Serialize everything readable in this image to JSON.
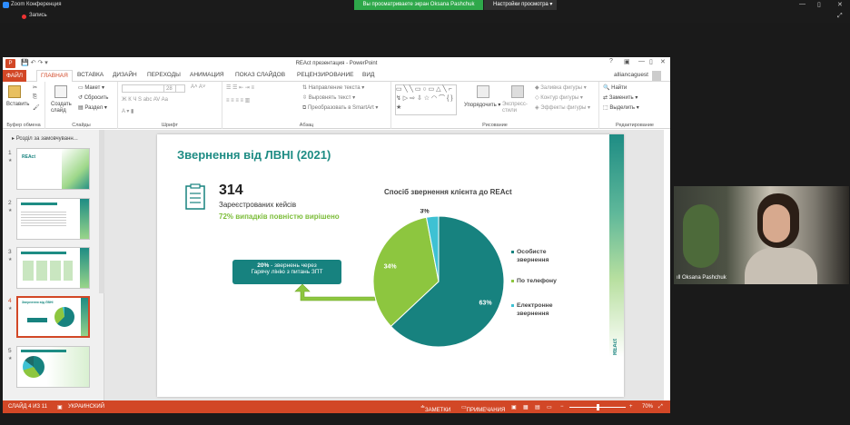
{
  "zoom": {
    "app_title": "Zoom Конференция",
    "share_banner": "Вы просматриваете экран Oksana Pashchuk",
    "share_settings": "Настройки просмотра",
    "record_label": "Запись"
  },
  "ppt": {
    "window_title": "REAct презентация - PowerPoint",
    "tabs": [
      "ФАЙЛ",
      "ГЛАВНАЯ",
      "ВСТАВКА",
      "ДИЗАЙН",
      "ПЕРЕХОДЫ",
      "АНИМАЦИЯ",
      "ПОКАЗ СЛАЙДОВ",
      "РЕЦЕНЗИРОВАНИЕ",
      "ВИД"
    ],
    "user": "alliancaguest",
    "ribbon": {
      "paste": "Вставить",
      "clipboard": "Буфер обмена",
      "create_slide": "Создать слайд",
      "layout": "Макет",
      "reset": "Сбросить",
      "section": "Раздел",
      "slides": "Слайды",
      "font_size": "28",
      "font": "Шрифт",
      "text_direction": "Направление текста",
      "align_text": "Выровнять текст",
      "smartart": "Преобразовать в SmartArt",
      "paragraph": "Абзац",
      "arrange": "Упорядочить",
      "quick_styles": "Экспресс-стили",
      "fill": "Заливка фигуры",
      "outline": "Контур фигуры",
      "effects": "Эффекты фигуры",
      "drawing": "Рисование",
      "find": "Найти",
      "replace": "Заменить",
      "select": "Выделить",
      "editing": "Редактирование"
    },
    "section_title": "Розділ за замовчуванн...",
    "thumbnails": [
      {
        "num": "1",
        "text": "REAct"
      },
      {
        "num": "2",
        "text": ""
      },
      {
        "num": "3",
        "text": ""
      },
      {
        "num": "4",
        "text": "Звернення від ЛВНІ"
      },
      {
        "num": "5",
        "text": ""
      }
    ],
    "status": {
      "slide": "СЛАЙД 4 ИЗ 11",
      "lang": "УКРАИНСКИЙ",
      "notes": "ЗАМЕТКИ",
      "comments": "ПРИМЕЧАНИЯ",
      "zoom": "70%"
    }
  },
  "slide": {
    "title": "Звернення від ЛВНІ (2021)",
    "big_number": "314",
    "line1": "Зареєстрованих кейсів",
    "line2": "72% випадків повністю вирішено",
    "callout_bold": "20%",
    "callout_rest": " - звернень через",
    "callout_line2": "Гарячу лінію з питань ЗПТ",
    "logo": "REAct"
  },
  "chart_data": {
    "type": "pie",
    "title": "Спосіб звернення клієнта до REAct",
    "categories": [
      "Особисте звернення",
      "По телефону",
      "Електронне звернення"
    ],
    "values": [
      63,
      34,
      3
    ],
    "labels": [
      "63%",
      "34%",
      "3%"
    ],
    "colors": [
      "#17827f",
      "#8dc63f",
      "#3ec1d3"
    ],
    "legend_position": "right"
  },
  "video": {
    "participant": "Oksana Pashchuk"
  }
}
